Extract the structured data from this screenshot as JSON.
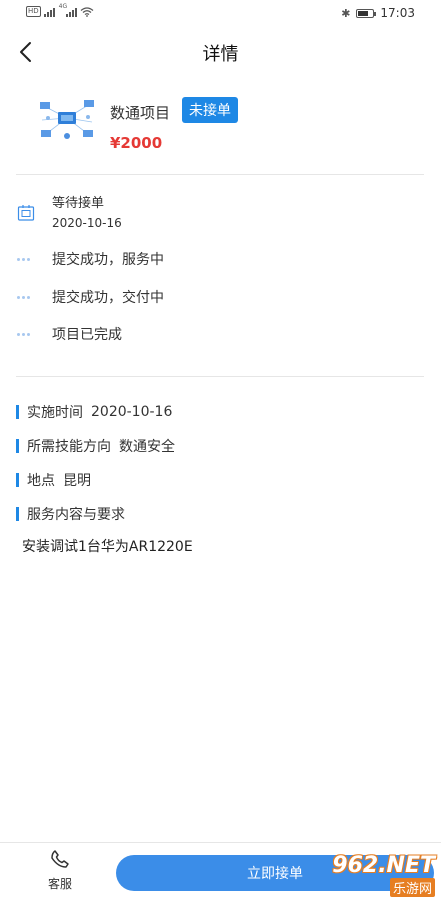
{
  "status_bar": {
    "time": "17:03",
    "hd_badge": "HD",
    "signal_tag": "4G"
  },
  "header": {
    "title": "详情"
  },
  "project": {
    "name": "数通项目",
    "status_tag": "未接单",
    "price": "¥2000"
  },
  "timeline": [
    {
      "title": "等待接单",
      "date": "2020-10-16"
    },
    {
      "title": "提交成功，服务中"
    },
    {
      "title": "提交成功，交付中"
    },
    {
      "title": "项目已完成"
    }
  ],
  "info": {
    "date_label": "实施时间",
    "date_value": "2020-10-16",
    "skill_label": "所需技能方向",
    "skill_value": "数通安全",
    "location_label": "地点",
    "location_value": "昆明",
    "content_label": "服务内容与要求",
    "content_value": "安装调试1台华为AR1220E"
  },
  "bottom_bar": {
    "service_label": "客服",
    "accept_label": "立即接单"
  },
  "watermark": {
    "logo": "962.NET",
    "sub": "乐游网"
  },
  "colors": {
    "accent": "#1e88e5",
    "button": "#3b8de8",
    "price": "#e53935"
  }
}
